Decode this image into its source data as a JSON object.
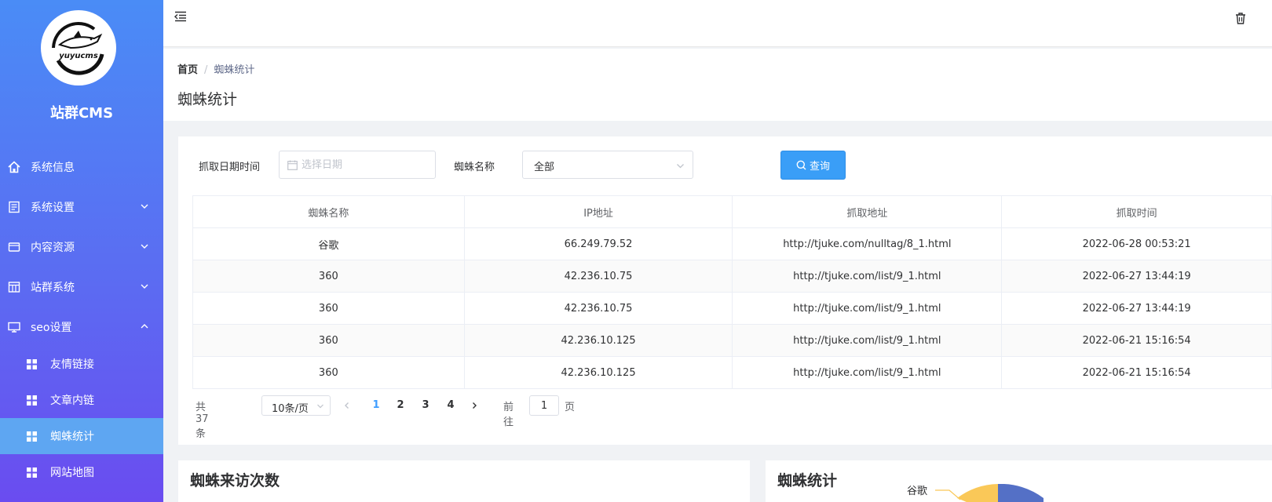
{
  "sidebar": {
    "brand": "站群CMS",
    "items": [
      {
        "label": "系统信息"
      },
      {
        "label": "系统设置"
      },
      {
        "label": "内容资源"
      },
      {
        "label": "站群系统"
      },
      {
        "label": "seo设置"
      }
    ],
    "sub_items": [
      {
        "label": "友情链接"
      },
      {
        "label": "文章内链"
      },
      {
        "label": "蜘蛛统计"
      },
      {
        "label": "网站地图"
      }
    ]
  },
  "breadcrumb": {
    "home": "首页",
    "separator": "/",
    "current": "蜘蛛统计"
  },
  "page_title": "蜘蛛统计",
  "filters": {
    "date_label": "抓取日期时间",
    "date_placeholder": "选择日期",
    "spider_label": "蜘蛛名称",
    "spider_value": "全部",
    "query_label": "查询"
  },
  "table": {
    "headers": [
      "蜘蛛名称",
      "IP地址",
      "抓取地址",
      "抓取时间"
    ],
    "rows": [
      [
        "谷歌",
        "66.249.79.52",
        "http://tjuke.com/nulltag/8_1.html",
        "2022-06-28 00:53:21"
      ],
      [
        "360",
        "42.236.10.75",
        "http://tjuke.com/list/9_1.html",
        "2022-06-27 13:44:19"
      ],
      [
        "360",
        "42.236.10.75",
        "http://tjuke.com/list/9_1.html",
        "2022-06-27 13:44:19"
      ],
      [
        "360",
        "42.236.10.125",
        "http://tjuke.com/list/9_1.html",
        "2022-06-21 15:16:54"
      ],
      [
        "360",
        "42.236.10.125",
        "http://tjuke.com/list/9_1.html",
        "2022-06-21 15:16:54"
      ]
    ]
  },
  "pagination": {
    "total": "共 37 条",
    "page_size": "10条/页",
    "pages": [
      "1",
      "2",
      "3",
      "4"
    ],
    "goto_prefix": "前往",
    "goto_value": "1",
    "goto_suffix": "页"
  },
  "panels": {
    "visits_title": "蜘蛛来访次数",
    "stats_title": "蜘蛛统计",
    "pie_label": "谷歌"
  },
  "colors": {
    "sidebar_top": "#4a8cf6",
    "sidebar_bottom": "#6a4cf0",
    "active_item": "#5ea6f2",
    "primary_button": "#3a9ef7",
    "active_page": "#409eff",
    "pie_blue": "#5470c6",
    "pie_yellow": "#fac858"
  }
}
